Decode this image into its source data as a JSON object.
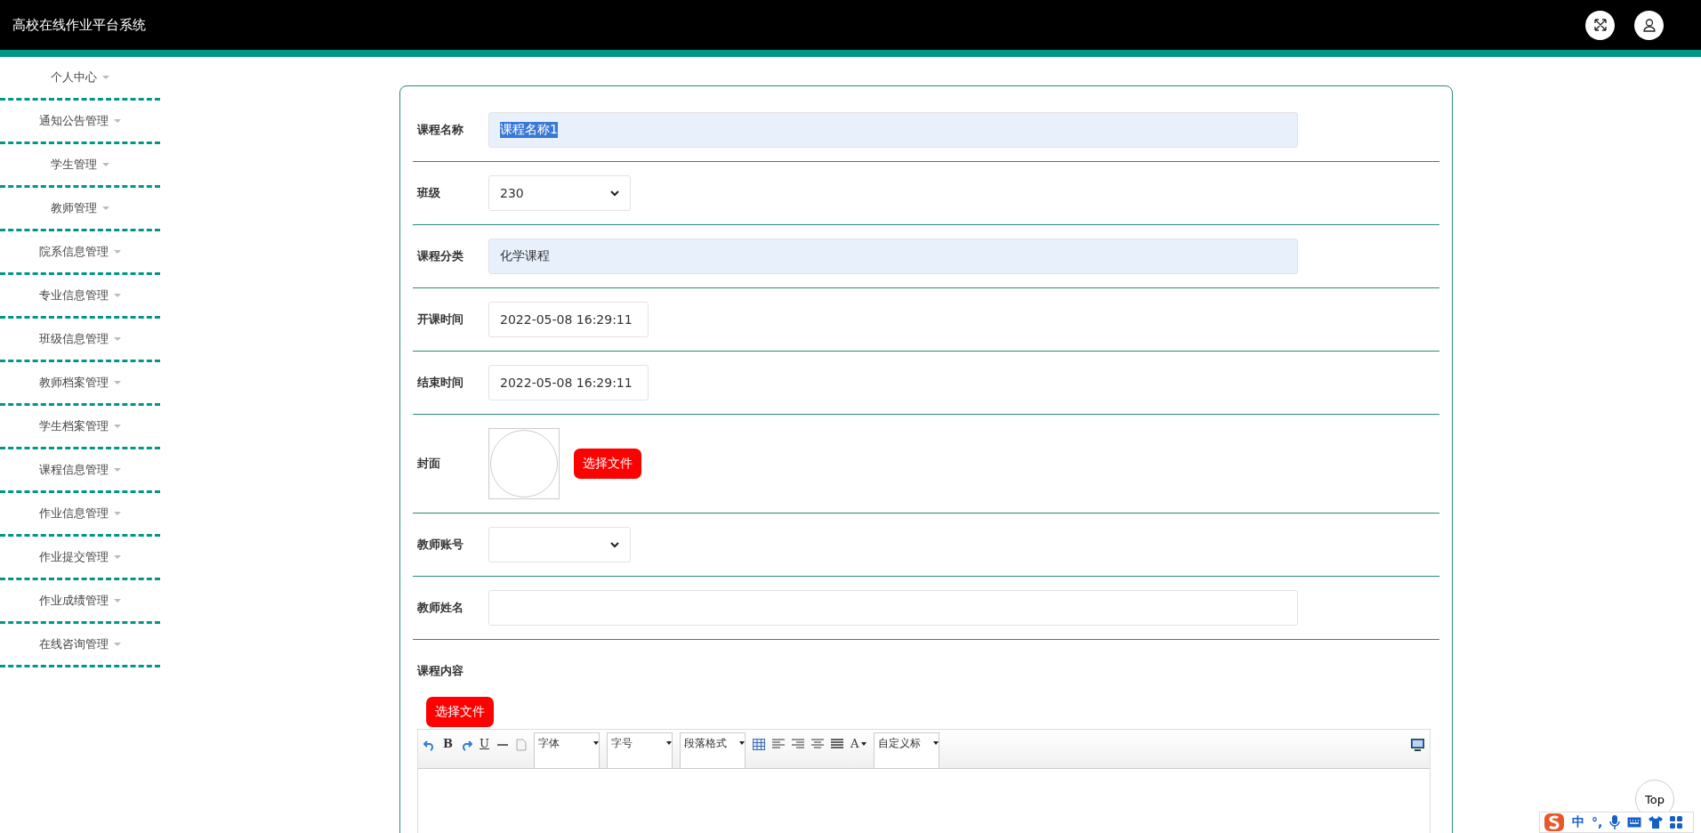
{
  "header": {
    "title": "高校在线作业平台系统"
  },
  "sidebar": {
    "items": [
      {
        "label": "个人中心"
      },
      {
        "label": "通知公告管理"
      },
      {
        "label": "学生管理"
      },
      {
        "label": "教师管理"
      },
      {
        "label": "院系信息管理"
      },
      {
        "label": "专业信息管理"
      },
      {
        "label": "班级信息管理"
      },
      {
        "label": "教师档案管理"
      },
      {
        "label": "学生档案管理"
      },
      {
        "label": "课程信息管理"
      },
      {
        "label": "作业信息管理"
      },
      {
        "label": "作业提交管理"
      },
      {
        "label": "作业成绩管理"
      },
      {
        "label": "在线咨询管理"
      }
    ]
  },
  "form": {
    "fields": [
      {
        "kind": "input",
        "label": "课程名称",
        "value": "课程名称1",
        "readonly": true,
        "text_selected": true
      },
      {
        "kind": "select",
        "label": "班级",
        "value": "230"
      },
      {
        "kind": "input",
        "label": "课程分类",
        "value": "化学课程",
        "readonly": true,
        "text_selected": false
      },
      {
        "kind": "date",
        "label": "开课时间",
        "value": "2022-05-08 16:29:11"
      },
      {
        "kind": "date",
        "label": "结束时间",
        "value": "2022-05-08 16:29:11"
      },
      {
        "kind": "upload",
        "label": "封面",
        "button": "选择文件"
      },
      {
        "kind": "select",
        "label": "教师账号"
      },
      {
        "kind": "input",
        "label": "教师姓名",
        "readonly": false
      }
    ],
    "content": {
      "label": "课程内容",
      "button": "选择文件",
      "toolbar": [
        {
          "kind": "undo"
        },
        {
          "kind": "bold",
          "label": "B"
        },
        {
          "kind": "redo"
        },
        {
          "kind": "underline",
          "label": "U"
        },
        {
          "kind": "rule"
        },
        {
          "kind": "page"
        },
        {
          "kind": "dropdown",
          "label": "字体"
        },
        {
          "kind": "dropdown",
          "label": "字号"
        },
        {
          "kind": "dropdown",
          "label": "段落格式"
        },
        {
          "kind": "table"
        },
        {
          "kind": "align-left"
        },
        {
          "kind": "align-right"
        },
        {
          "kind": "align-center"
        },
        {
          "kind": "justify"
        },
        {
          "kind": "font-color",
          "label": "A"
        },
        {
          "kind": "dropdown",
          "label": "自定义标"
        },
        {
          "kind": "preview"
        }
      ]
    }
  },
  "top_button": "Top",
  "ime_bar": {
    "items": [
      "中",
      "°,"
    ]
  }
}
